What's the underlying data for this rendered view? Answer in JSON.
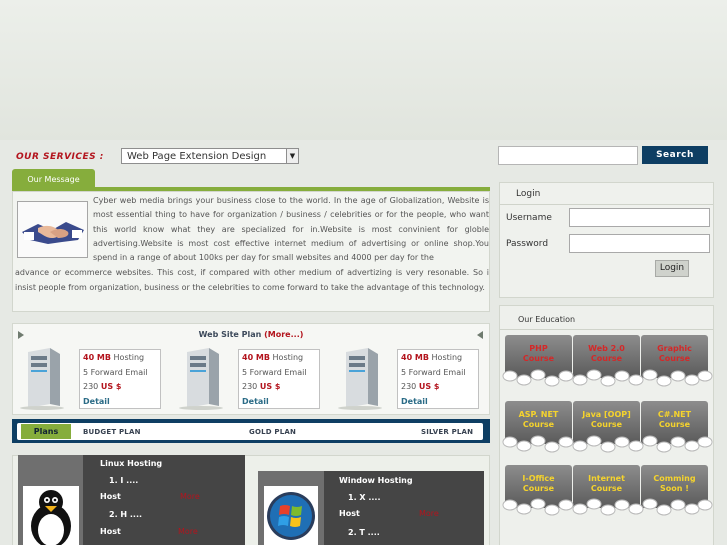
{
  "services": {
    "label": "OUR SERVICES :",
    "selected": "Web Page Extension Design",
    "search_button": "Search"
  },
  "message": {
    "tab": "Our Message",
    "text_a": "Cyber web media brings your business close to the world. In the age of Globalization, Website is most essential thing to have for organization / business / celebrities or for the people, who want this world know what they are specialized for in.Website is most convinient for globle advertising.Website is most cost effective internet medium of advertising or online shop.You spend in a range of about 100ks per day for small websites and 4000 per day for the",
    "text_b": "advance or ecommerce websites. This cost, if compared with other medium of advertizing is very resonable. So i insist people from organization, business or the celebrities to come forward to take the advantage of this technology."
  },
  "plan": {
    "title": "Web Site Plan",
    "more": "(More...)",
    "cards": [
      {
        "hosting_size": "40 MB",
        "hosting_label": "Hosting",
        "email": "5 Forward Email",
        "price": "230",
        "currency": "US $",
        "detail": "Detail"
      },
      {
        "hosting_size": "40 MB",
        "hosting_label": "Hosting",
        "email": "5 Forward Email",
        "price": "230",
        "currency": "US $",
        "detail": "Detail"
      },
      {
        "hosting_size": "40 MB",
        "hosting_label": "Hosting",
        "email": "5 Forward Email",
        "price": "230",
        "currency": "US $",
        "detail": "Detail"
      }
    ]
  },
  "plans_bar": {
    "tab": "Plans",
    "budget": "BUDGET PLAN",
    "gold": "GOLD PLAN",
    "silver": "SILVER PLAN"
  },
  "hosting": {
    "linux": {
      "title": "Linux Hosting",
      "item1": "1. I ....",
      "host1": "Host",
      "more1": "More",
      "item2": "2. H ....",
      "host2": "Host",
      "more2": "More"
    },
    "windows": {
      "title": "Window Hosting",
      "item1": "1. X ....",
      "host1": "Host",
      "more1": "More",
      "item2": "2. T ...."
    }
  },
  "login": {
    "title": "Login",
    "username_label": "Username",
    "password_label": "Password",
    "button": "Login"
  },
  "education": {
    "title": "Our Education",
    "tiles": [
      [
        "PHP",
        "Course"
      ],
      [
        "Web 2.0",
        "Course"
      ],
      [
        "Graphic",
        "Course"
      ],
      [
        "ASP. NET",
        "Course"
      ],
      [
        "Java [OOP]",
        "Course"
      ],
      [
        "C#.NET",
        "Course"
      ],
      [
        "I-Office",
        "Course"
      ],
      [
        "Internet",
        "Course"
      ],
      [
        "Comming",
        "Soon !"
      ]
    ]
  },
  "colors": {
    "accent_green": "#86ad3c",
    "navy": "#0e3e63",
    "brand_red": "#b3141d"
  }
}
